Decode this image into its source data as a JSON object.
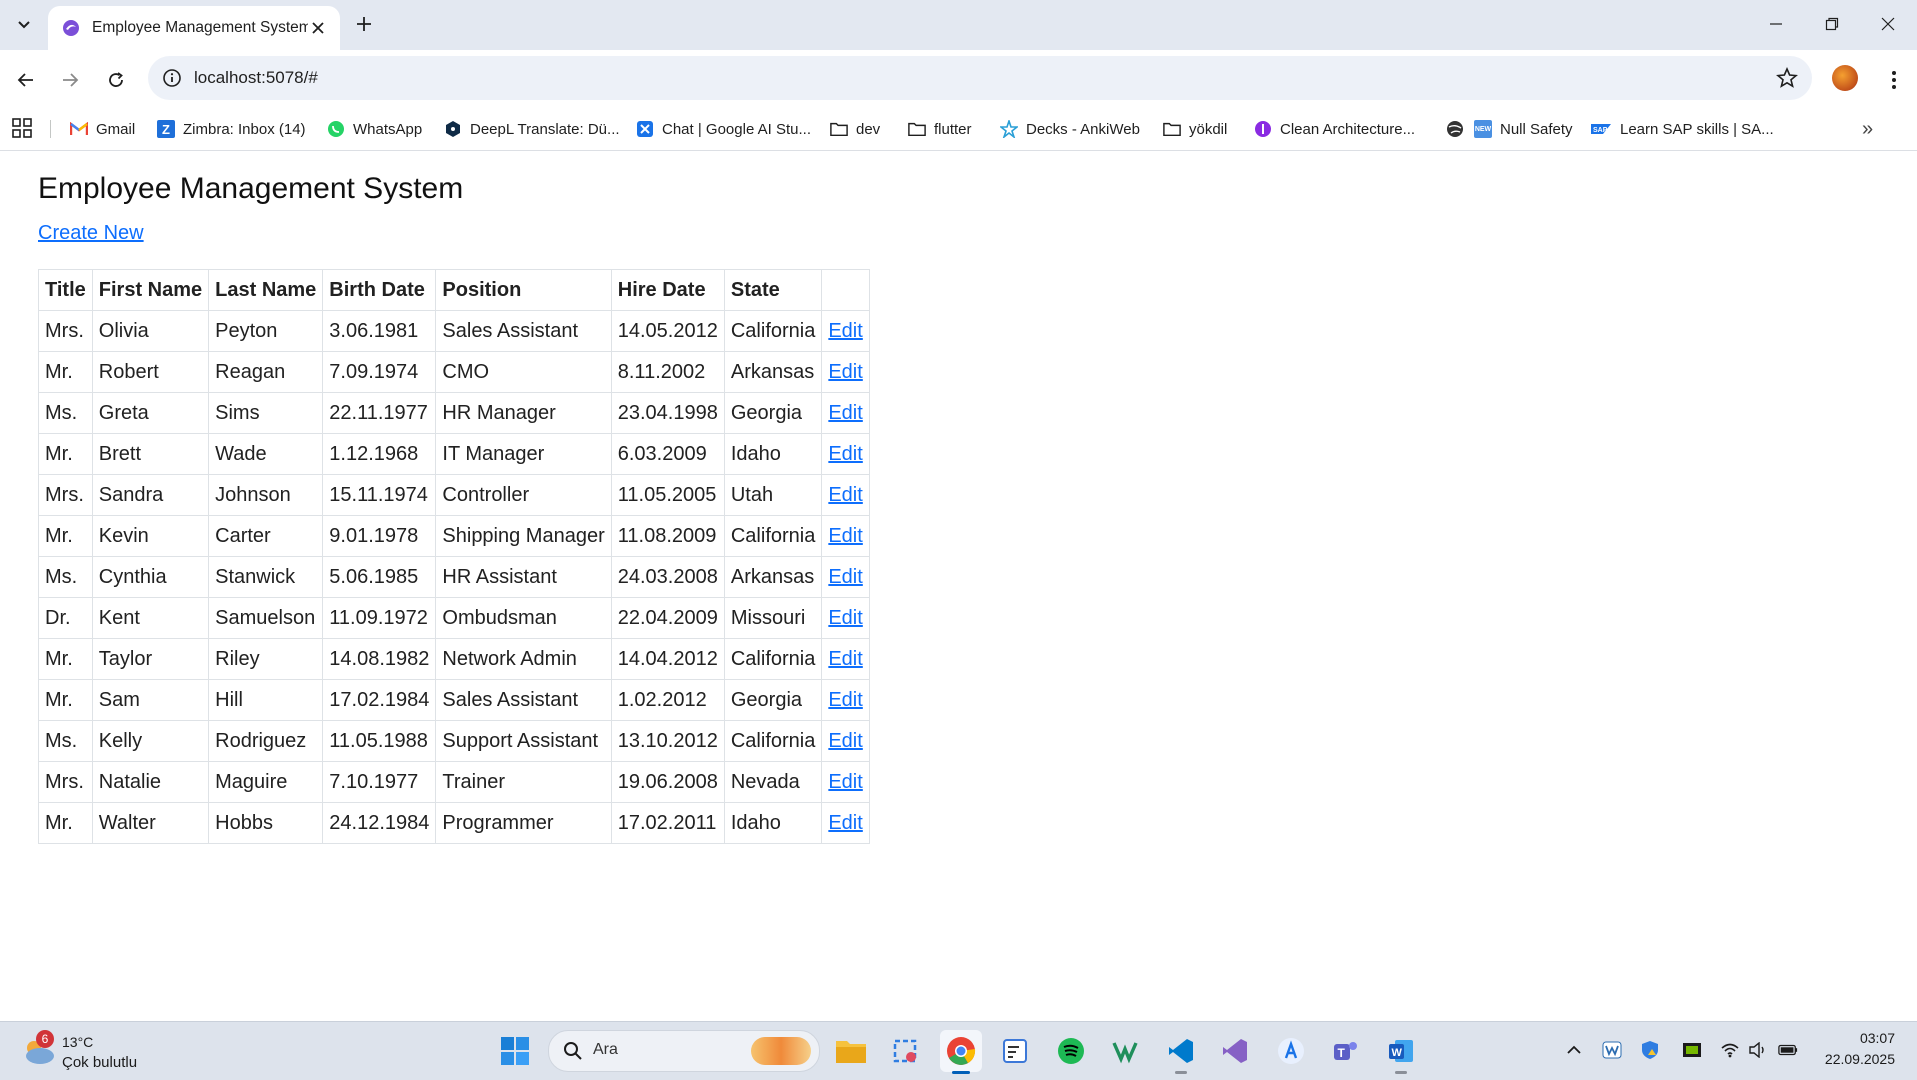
{
  "browser": {
    "tab": {
      "title": "Employee Management System"
    },
    "address_bar": {
      "url": "localhost:5078/#"
    },
    "bookmarks": [
      {
        "label": "Gmail",
        "icon": "gmail-icon"
      },
      {
        "label": "Zimbra: Inbox (14)",
        "icon": "zimbra-icon"
      },
      {
        "label": "WhatsApp",
        "icon": "whatsapp-icon"
      },
      {
        "label": "DeepL Translate: Dü...",
        "icon": "deepl-icon"
      },
      {
        "label": "Chat | Google AI Stu...",
        "icon": "google-ai-studio-icon"
      },
      {
        "label": "dev",
        "icon": "folder-icon"
      },
      {
        "label": "flutter",
        "icon": "folder-icon"
      },
      {
        "label": "Decks - AnkiWeb",
        "icon": "anki-icon"
      },
      {
        "label": "yökdil",
        "icon": "folder-icon"
      },
      {
        "label": "Clean Architecture...",
        "icon": "clean-architecture-icon"
      },
      {
        "label": "",
        "icon": "globe-icon"
      },
      {
        "label": "Null Safety",
        "icon": "null-safety-icon"
      },
      {
        "label": "Learn SAP skills | SA...",
        "icon": "sap-icon"
      }
    ]
  },
  "page": {
    "title": "Employee Management System",
    "create_link": "Create New",
    "table": {
      "headers": [
        "Title",
        "First Name",
        "Last Name",
        "Birth Date",
        "Position",
        "Hire Date",
        "State",
        ""
      ],
      "action_label": "Edit",
      "rows": [
        [
          "Mrs.",
          "Olivia",
          "Peyton",
          "3.06.1981",
          "Sales Assistant",
          "14.05.2012",
          "California"
        ],
        [
          "Mr.",
          "Robert",
          "Reagan",
          "7.09.1974",
          "CMO",
          "8.11.2002",
          "Arkansas"
        ],
        [
          "Ms.",
          "Greta",
          "Sims",
          "22.11.1977",
          "HR Manager",
          "23.04.1998",
          "Georgia"
        ],
        [
          "Mr.",
          "Brett",
          "Wade",
          "1.12.1968",
          "IT Manager",
          "6.03.2009",
          "Idaho"
        ],
        [
          "Mrs.",
          "Sandra",
          "Johnson",
          "15.11.1974",
          "Controller",
          "11.05.2005",
          "Utah"
        ],
        [
          "Mr.",
          "Kevin",
          "Carter",
          "9.01.1978",
          "Shipping Manager",
          "11.08.2009",
          "California"
        ],
        [
          "Ms.",
          "Cynthia",
          "Stanwick",
          "5.06.1985",
          "HR Assistant",
          "24.03.2008",
          "Arkansas"
        ],
        [
          "Dr.",
          "Kent",
          "Samuelson",
          "11.09.1972",
          "Ombudsman",
          "22.04.2009",
          "Missouri"
        ],
        [
          "Mr.",
          "Taylor",
          "Riley",
          "14.08.1982",
          "Network Admin",
          "14.04.2012",
          "California"
        ],
        [
          "Mr.",
          "Sam",
          "Hill",
          "17.02.1984",
          "Sales Assistant",
          "1.02.2012",
          "Georgia"
        ],
        [
          "Ms.",
          "Kelly",
          "Rodriguez",
          "11.05.1988",
          "Support Assistant",
          "13.10.2012",
          "California"
        ],
        [
          "Mrs.",
          "Natalie",
          "Maguire",
          "7.10.1977",
          "Trainer",
          "19.06.2008",
          "Nevada"
        ],
        [
          "Mr.",
          "Walter",
          "Hobbs",
          "24.12.1984",
          "Programmer",
          "17.02.2011",
          "Idaho"
        ]
      ]
    }
  },
  "taskbar": {
    "weather": {
      "badge": "6",
      "temperature": "13°C",
      "condition": "Çok bulutlu"
    },
    "search_placeholder": "Ara",
    "clock": {
      "time": "03:07",
      "date": "22.09.2025"
    }
  },
  "colors": {
    "link": "#0d6efd",
    "tabstrip": "#e3e8f1",
    "taskbar": "#dde3ec"
  }
}
